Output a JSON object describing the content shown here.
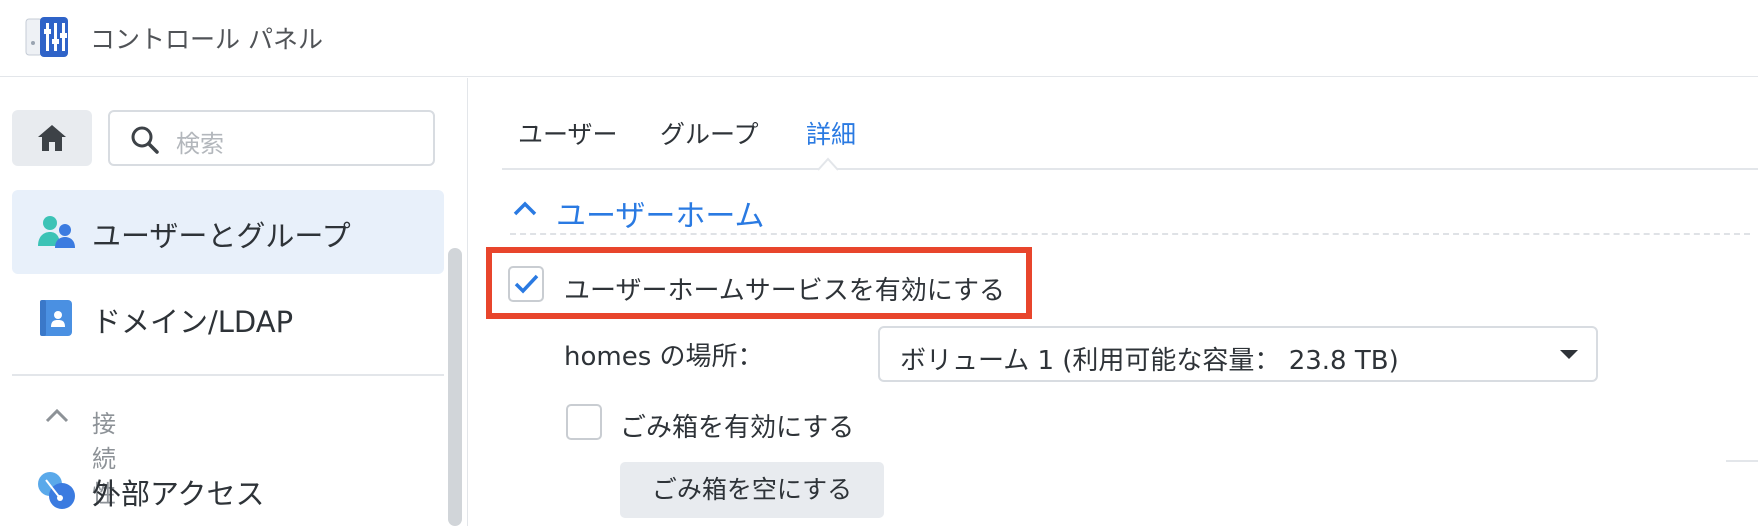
{
  "window": {
    "title": "コントロール パネル",
    "icon": "control-panel-icon"
  },
  "sidebar": {
    "home_icon": "home-icon",
    "search": {
      "placeholder": "検索",
      "icon": "search-icon"
    },
    "items": [
      {
        "label": "ユーザーとグループ",
        "icon": "users-groups-icon",
        "active": true
      },
      {
        "label": "ドメイン/LDAP",
        "icon": "domain-ldap-icon",
        "active": false
      }
    ],
    "section": {
      "label": "接続性",
      "icon": "chevron-up-icon"
    },
    "section_items": [
      {
        "label": "外部アクセス",
        "icon": "external-access-icon"
      }
    ]
  },
  "main": {
    "tabs": [
      {
        "label": "ユーザー",
        "active": false
      },
      {
        "label": "グループ",
        "active": false
      },
      {
        "label": "詳細",
        "active": true
      }
    ],
    "group": {
      "title": "ユーザーホーム",
      "enable_home": {
        "label": "ユーザーホームサービスを有効にする",
        "checked": true
      },
      "homes_location": {
        "label": "homes の場所：",
        "value": "ボリューム 1 (利用可能な容量： 23.8 TB)"
      },
      "enable_recycle": {
        "label": "ごみ箱を有効にする",
        "checked": false
      },
      "empty_recycle_button": "ごみ箱を空にする"
    }
  },
  "colors": {
    "accent": "#2a7ae2",
    "highlight_border": "#e8452c",
    "active_nav_bg": "#e8f0fa"
  }
}
